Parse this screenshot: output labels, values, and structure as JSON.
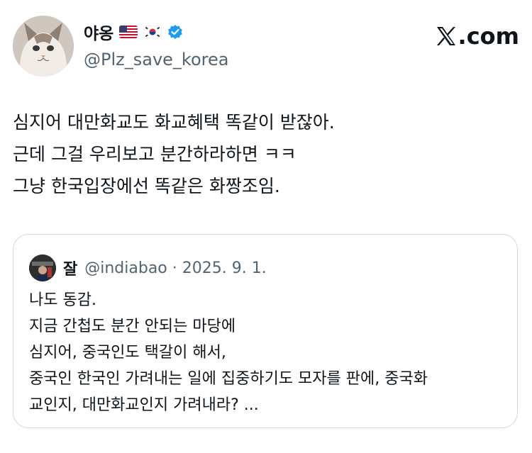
{
  "author": {
    "display_name": "야옹",
    "handle": "@Plz_save_korea",
    "flags": [
      "us-flag-icon",
      "kr-flag-icon"
    ],
    "verified": true
  },
  "brand": {
    "label": ".com"
  },
  "tweet": {
    "lines": [
      "심지어 대만화교도 화교혜택 똑같이 받잖아.",
      "근데 그걸 우리보고 분간하라하면 ㅋㅋ",
      "그냥 한국입장에선 똑같은 화짱조임."
    ]
  },
  "quote": {
    "name": "잘",
    "meta": "@indiabao · 2025. 9. 1.",
    "lines": [
      "나도 동감.",
      "지금 간첩도 분간 안되는 마당에",
      "심지어, 중국인도 택갈이 해서,",
      "중국인 한국인 가려내는 일에 집중하기도 모자를 판에, 중국화",
      "교인지, 대만화교인지 가려내라? ..."
    ]
  },
  "colors": {
    "verified": "#1d9bf0",
    "secondary_text": "#536471",
    "border": "#cfd9de"
  }
}
